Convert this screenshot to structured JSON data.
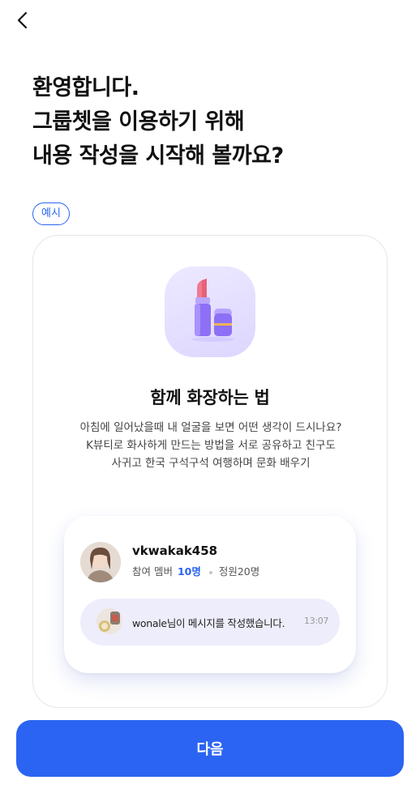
{
  "header": {
    "back_icon": "chevron-left-icon"
  },
  "headline": {
    "lines": [
      "환영합니다.",
      "그룹쳇을 이용하기 위해",
      "내용 작성을 시작해 볼까요?"
    ]
  },
  "example_badge": "예시",
  "card": {
    "icon": "lipstick-icon",
    "title": "함께 화장하는 법",
    "description": [
      "아침에 일어났을때 내 얼굴을 보면 어떤 생각이 드시나요?",
      "K뷰티로 화사하게 만드는 방법을 서로 공유하고 친구도",
      "사귀고 한국 구석구석 여행하며 문화 배우기"
    ],
    "preview": {
      "username": "vkwakak458",
      "member_label": "참여 멤버",
      "member_count": "10명",
      "capacity": "정원20명",
      "message": {
        "text": "wonale님이 메시지를 작성했습니다.",
        "time": "13:07"
      }
    }
  },
  "next_button": "다음",
  "colors": {
    "accent": "#2b64f2",
    "icon_tile": "#e6e0ff",
    "bubble": "#eeedfb"
  }
}
